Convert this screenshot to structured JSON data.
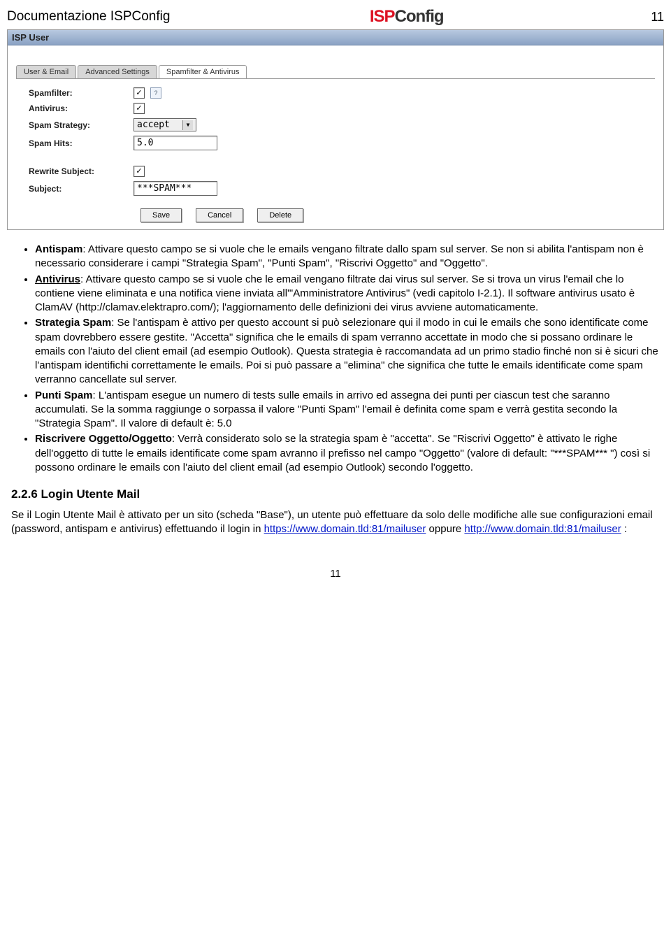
{
  "header": {
    "left": "Documentazione ISPConfig",
    "logo_a": "ISP",
    "logo_b": "Config",
    "page_no": "11"
  },
  "panel": {
    "title": "ISP User",
    "tabs": [
      "User & Email",
      "Advanced Settings",
      "Spamfilter & Antivirus"
    ],
    "active_tab_index": 2,
    "fields": {
      "spamfilter_label": "Spamfilter:",
      "antivirus_label": "Antivirus:",
      "strategy_label": "Spam Strategy:",
      "strategy_value": "accept",
      "hits_label": "Spam Hits:",
      "hits_value": "5.0",
      "rewrite_label": "Rewrite Subject:",
      "subject_label": "Subject:",
      "subject_value": "***SPAM***"
    },
    "buttons": {
      "save": "Save",
      "cancel": "Cancel",
      "delete": "Delete"
    }
  },
  "bullets": {
    "antispam_b": "Antispam",
    "antispam_t": ": Attivare questo campo se si vuole che le emails vengano filtrate dallo spam sul server. Se non si abilita l'antispam non è necessario considerare i campi \"Strategia Spam\", \"Punti Spam\", \"Riscrivi Oggetto\" and \"Oggetto\".",
    "antivirus_b": "Antivirus",
    "antivirus_t": ": Attivare questo campo se si vuole che le email vengano filtrate dai virus sul server. Se si trova un virus l'email che lo contiene viene eliminata e una notifica viene inviata all'\"Amministratore Antivirus\" (vedi capitolo I-2.1). Il software antivirus usato è ClamAV (http://clamav.elektrapro.com/); l'aggiornamento delle definizioni dei virus avviene automaticamente.",
    "strategia_b": "Strategia Spam",
    "strategia_t": ": Se l'antispam è attivo per questo account si può selezionare qui il modo in cui le emails che sono identificate come spam dovrebbero essere gestite. \"Accetta\" significa che le emails di spam verranno accettate in modo che si possano ordinare le emails con l'aiuto del client email (ad esempio Outlook). Questa strategia è raccomandata ad un primo stadio finché non si è sicuri che l'antispam identifichi correttamente le emails. Poi si può passare a \"elimina\" che significa che tutte le emails identificate come spam verranno cancellate sul server.",
    "punti_b": "Punti Spam",
    "punti_t": ": L'antispam esegue un numero di tests sulle emails in arrivo ed assegna dei punti per ciascun test che saranno accumulati. Se la somma raggiunge o sorpassa il valore \"Punti Spam\" l'email è definita come spam e verrà gestita secondo la \"Strategia Spam\". Il valore di default è: 5.0",
    "riscrivere_b": "Riscrivere Oggetto/Oggetto",
    "riscrivere_t": ": Verrà considerato solo se la strategia spam è \"accetta\". Se \"Riscrivi Oggetto\" è attivato le righe dell'oggetto di tutte le emails identificate come spam avranno il prefisso nel campo \"Oggetto\" (valore di default: \"***SPAM*** \") così si possono ordinare le emails con l'aiuto del client email (ad esempio Outlook) secondo l'oggetto."
  },
  "section": {
    "heading": "2.2.6 Login Utente Mail",
    "para_a": "Se il Login Utente Mail è attivato per un sito (scheda \"Base\"), un utente può effettuare da solo delle modifiche alle sue configurazioni email (password, antispam e antivirus) effettuando il login in ",
    "link1": "https://www.domain.tld:81/mailuser",
    "mid": " oppure ",
    "link2": "http://www.domain.tld:81/mailuser",
    "tail": " :"
  },
  "footer_pg": "11"
}
